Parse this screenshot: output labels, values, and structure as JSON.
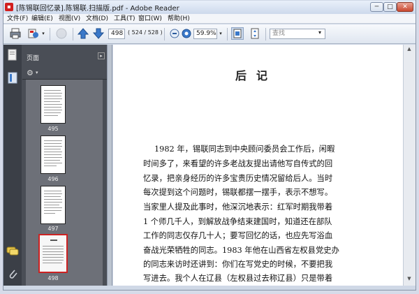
{
  "window": {
    "title": "[陈锡联回忆录].陈锡联.扫描版.pdf - Adobe Reader",
    "min_glyph": "─",
    "max_glyph": "□",
    "close_glyph": "✕"
  },
  "menu": [
    {
      "label": "文件(F)"
    },
    {
      "label": "编辑(E)"
    },
    {
      "label": "视图(V)"
    },
    {
      "label": "文档(D)"
    },
    {
      "label": "工具(T)"
    },
    {
      "label": "窗口(W)"
    },
    {
      "label": "帮助(H)"
    }
  ],
  "toolbar": {
    "page_value": "498",
    "page_info": "( 524 / 528 )",
    "zoom_value": "59.9%",
    "search_placeholder": "查找"
  },
  "nav": {
    "pages_label": "页面",
    "thumbnails": [
      {
        "label": "495",
        "selected": false
      },
      {
        "label": "496",
        "selected": false
      },
      {
        "label": "497",
        "selected": false
      },
      {
        "label": "498",
        "selected": true
      }
    ]
  },
  "document": {
    "title": "后记",
    "lines": [
      "1982 年，锡联同志到中央顾问委员会工作后，闲暇",
      "时间多了，来看望的许多老战友提出请他写自传式的回",
      "忆录，把亲身经历的许多宝贵历史情况留给后人。当时",
      "每次提到这个问题时，锡联都摆一摆手，表示不想写。",
      "当家里人提及此事时，他深沉地表示：红军时期我带着",
      "1 个师几千人，到解放战争结束建国时，知道还在部队",
      "工作的同志仅存几十人；要写回忆的话，也应先写浴血",
      "奋战光荣牺牲的同志。1983 年他在山西省左权县党史办",
      "的同志来访时还讲到：你们在写党史的时候，不要把我",
      "写进去。我个人在辽县（左权县过去称辽县）只是带着"
    ]
  },
  "colors": {
    "accent_red": "#d21f1f",
    "nav_dark": "#3b3f47",
    "selected_thumb": "#cc2222"
  }
}
